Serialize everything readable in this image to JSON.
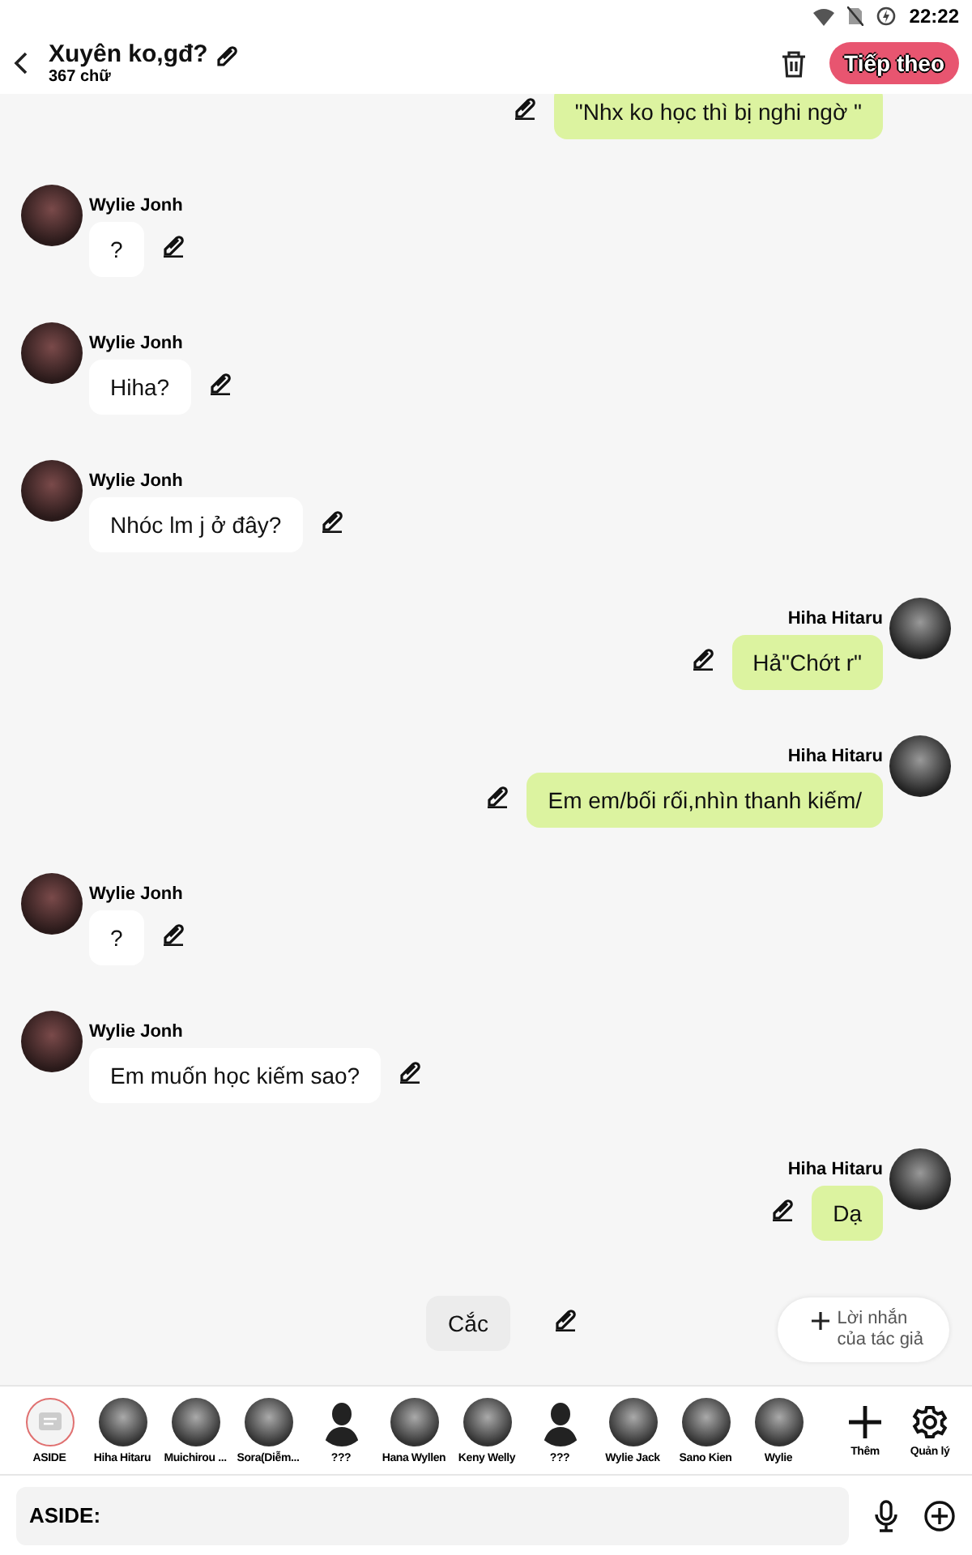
{
  "status_bar": {
    "time": "22:22"
  },
  "header": {
    "title": "Xuyên ko,gđ?",
    "subtitle": "367 chữ",
    "next_button": "Tiếp theo"
  },
  "messages": [
    {
      "kind": "right",
      "text": "\"Nhx ko học thì bị nghi ngờ \""
    },
    {
      "kind": "left",
      "name": "Wylie Jonh",
      "text": "?"
    },
    {
      "kind": "left",
      "name": "Wylie Jonh",
      "text": "Hiha?"
    },
    {
      "kind": "left",
      "name": "Wylie Jonh",
      "text": "Nhóc lm j ở đây?"
    },
    {
      "kind": "right",
      "name": "Hiha Hitaru",
      "text": "Hả\"Chớt r\""
    },
    {
      "kind": "right",
      "name": "Hiha Hitaru",
      "text": "Em em/bối rối,nhìn thanh kiếm/"
    },
    {
      "kind": "left",
      "name": "Wylie Jonh",
      "text": "?"
    },
    {
      "kind": "left",
      "name": "Wylie Jonh",
      "text": "Em muốn học kiếm sao?"
    },
    {
      "kind": "right",
      "name": "Hiha Hitaru",
      "text": "Dạ"
    },
    {
      "kind": "narration",
      "text": "Cắc"
    }
  ],
  "author_note_button": {
    "line_1": "Lời nhắn",
    "line_2": "của tác giả"
  },
  "characters": [
    {
      "name": "ASIDE",
      "kind": "aside",
      "selected": true
    },
    {
      "name": "Hiha Hitaru",
      "kind": "photo",
      "selected": false
    },
    {
      "name": "Muichirou ...",
      "kind": "photo",
      "selected": false
    },
    {
      "name": "Sora(Diễm...",
      "kind": "photo",
      "selected": false
    },
    {
      "name": "???",
      "kind": "silhouette",
      "selected": false
    },
    {
      "name": "Hana Wyllen",
      "kind": "photo",
      "selected": false
    },
    {
      "name": "Keny Welly",
      "kind": "photo",
      "selected": false
    },
    {
      "name": "???",
      "kind": "silhouette",
      "selected": false
    },
    {
      "name": "Wylie Jack",
      "kind": "photo",
      "selected": false
    },
    {
      "name": "Sano Kien",
      "kind": "photo",
      "selected": false
    },
    {
      "name": "Wylie",
      "kind": "photo",
      "selected": false
    }
  ],
  "character_actions": [
    {
      "kind": "add",
      "label": "Thêm"
    },
    {
      "kind": "manage",
      "label": "Quản lý"
    }
  ],
  "input": {
    "value": "ASIDE:"
  }
}
